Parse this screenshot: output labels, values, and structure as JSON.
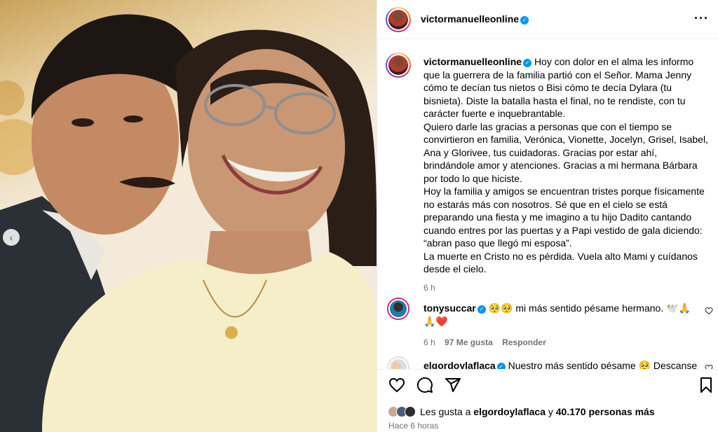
{
  "post": {
    "username": "victormanuelleonline",
    "more_icon": "more-horizontal-icon"
  },
  "caption": {
    "username": "victormanuelleonline",
    "paragraphs": [
      "Hoy con dolor en el alma les informo que la guerrera de la familia partió con el Señor. Mama Jenny cómo te decían tus nietos o Bisi cómo te decía Dylara (tu bisnieta). Diste la batalla hasta el final, no te rendiste, con tu carácter fuerte e inquebrantable.",
      "Quiero darle las gracias a personas que con el tiempo se convirtieron en familia, Verónica, Vionette, Jocelyn, Grisel, Isabel, Ana y Glorivee, tus cuidadoras. Gracias por estar ahí, brindándole amor y atenciones. Gracias a mi hermana Bárbara por todo lo que hiciste.",
      "Hoy la familia y amigos se encuentran tristes porque físicamente no estarás más con nosotros. Sé que en el cielo se está preparando una fiesta y me imagino a tu hijo Dadito cantando cuando entres por las puertas y a Papi vestido de gala diciendo: “abran paso que llegó mi esposa”.",
      "La muerte en Cristo no es pérdida. Vuela alto Mami y cuídanos desde el cielo."
    ],
    "time": "6 h"
  },
  "comments": [
    {
      "username": "tonysuccar",
      "text": "🥺🥺 mi más sentido pésame hermano. 🕊️🙏🙏❤️",
      "time": "6 h",
      "likes": "97 Me gusta",
      "reply": "Responder"
    },
    {
      "username": "elgordoylaflaca",
      "text": "Nuestro más sentido pésame 🥺 Descanse"
    }
  ],
  "actions": {
    "like_icon": "heart-icon",
    "comment_icon": "comment-icon",
    "share_icon": "share-icon",
    "save_icon": "bookmark-icon"
  },
  "likes": {
    "prefix": "Les gusta a",
    "user": "elgordoylaflaca",
    "conjunction": "y",
    "count": "40.170 personas más"
  },
  "posted_ago": "Hace 6 horas"
}
